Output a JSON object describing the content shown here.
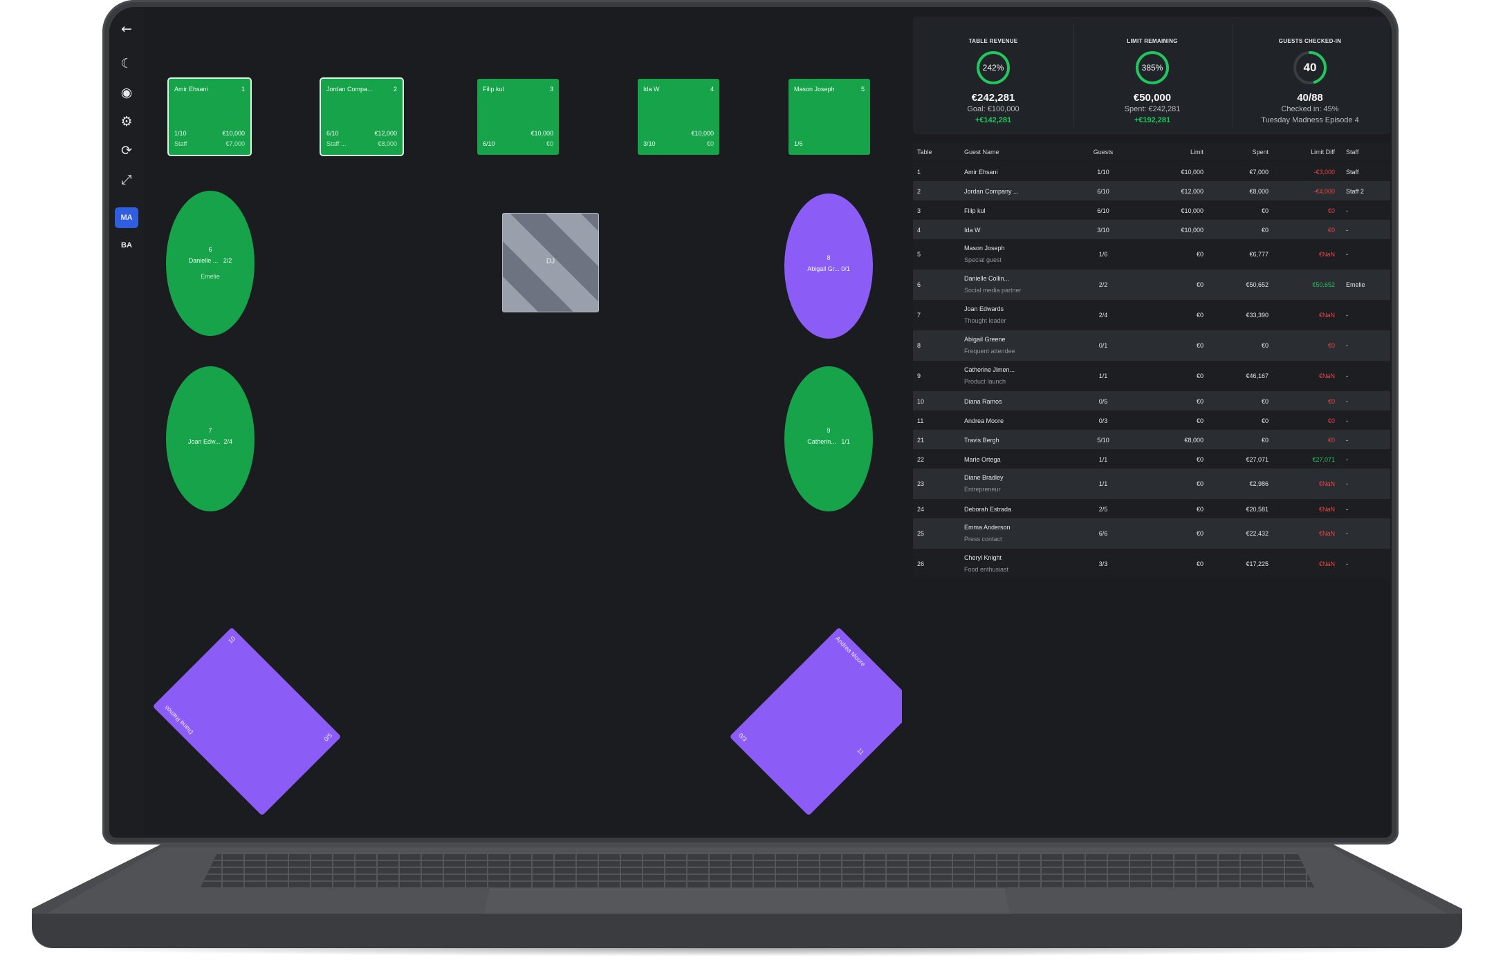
{
  "toolbar": {
    "badges": [
      "MA",
      "BA"
    ]
  },
  "tables": {
    "square": [
      {
        "name": "Amir Ehsani",
        "number": "1",
        "guests": "1/10",
        "limit": "€10,000",
        "staff": "Staff",
        "spent": "€7,000"
      },
      {
        "name": "Jordan Compa...",
        "number": "2",
        "guests": "6/10",
        "limit": "€12,000",
        "staff": "Staff ...",
        "spent": "€8,000"
      },
      {
        "name": "Filip kul",
        "number": "3",
        "guests": "6/10",
        "limit": "€10,000",
        "staff": "",
        "spent": "€0"
      },
      {
        "name": "Ida W",
        "number": "4",
        "guests": "3/10",
        "limit": "€10,000",
        "staff": "",
        "spent": "€0"
      },
      {
        "name": "Mason Joseph",
        "number": "5",
        "guests": "1/6",
        "limit": "",
        "staff": "",
        "spent": ""
      }
    ],
    "oval": [
      {
        "number": "6",
        "label": "Danielle ...",
        "count": "2/2",
        "extra": "Emelie"
      },
      {
        "number": "8",
        "label": "Abigail Gr...",
        "count": "0/1",
        "extra": ""
      },
      {
        "number": "7",
        "label": "Joan Edw...",
        "count": "2/4",
        "extra": ""
      },
      {
        "number": "9",
        "label": "Catherin...",
        "count": "1/1",
        "extra": ""
      }
    ],
    "dj_label": "DJ",
    "rotated": [
      {
        "name": "Diana Ramos",
        "number": "10",
        "count": "0/5"
      },
      {
        "name": "Andrea Moore",
        "number": "11",
        "count": "0/3"
      }
    ]
  },
  "stats": [
    {
      "label": "TABLE REVENUE",
      "ring_text": "242%",
      "value": "€242,281",
      "sub": "Goal: €100,000",
      "note": "+€142,281",
      "ring_fraction": 1.0
    },
    {
      "label": "LIMIT REMAINING",
      "ring_text": "385%",
      "value": "€50,000",
      "sub": "Spent: €242,281",
      "note": "+€192,281",
      "ring_fraction": 1.0
    },
    {
      "label": "GUESTS CHECKED-IN",
      "ring_text": "40",
      "value": "40/88",
      "sub": "Checked in: 45%",
      "note": "Tuesday Madness Episode 4",
      "ring_fraction": 0.45
    }
  ],
  "table_headers": [
    "Table",
    "Guest Name",
    "Guests",
    "Limit",
    "Spent",
    "Limit Diff",
    "Staff"
  ],
  "rows": [
    {
      "table": "1",
      "name": "Amir Ehsani",
      "note": "",
      "guests": "1/10",
      "limit": "€10,000",
      "spent": "€7,000",
      "diff": "-€3,000",
      "diff_type": "neg",
      "staff": "Staff"
    },
    {
      "table": "2",
      "name": "Jordan Company ...",
      "note": "",
      "guests": "6/10",
      "limit": "€12,000",
      "spent": "€8,000",
      "diff": "-€4,000",
      "diff_type": "neg",
      "staff": "Staff 2"
    },
    {
      "table": "3",
      "name": "Filip kul",
      "note": "",
      "guests": "6/10",
      "limit": "€10,000",
      "spent": "€0",
      "diff": "€0",
      "diff_type": "neg",
      "staff": "-"
    },
    {
      "table": "4",
      "name": "Ida W",
      "note": "",
      "guests": "3/10",
      "limit": "€10,000",
      "spent": "€0",
      "diff": "€0",
      "diff_type": "neg",
      "staff": "-"
    },
    {
      "table": "5",
      "name": "Mason Joseph",
      "note": "Special guest",
      "guests": "1/6",
      "limit": "€0",
      "spent": "€6,777",
      "diff": "€NaN",
      "diff_type": "neg",
      "staff": "-"
    },
    {
      "table": "6",
      "name": "Danielle Collin...",
      "note": "Social media partner",
      "guests": "2/2",
      "limit": "€0",
      "spent": "€50,652",
      "diff": "€50,652",
      "diff_type": "pos",
      "staff": "Emelie"
    },
    {
      "table": "7",
      "name": "Joan Edwards",
      "note": "Thought leader",
      "guests": "2/4",
      "limit": "€0",
      "spent": "€33,390",
      "diff": "€NaN",
      "diff_type": "neg",
      "staff": "-"
    },
    {
      "table": "8",
      "name": "Abigail Greene",
      "note": "Frequent attendee",
      "guests": "0/1",
      "limit": "€0",
      "spent": "€0",
      "diff": "€0",
      "diff_type": "neg",
      "staff": "-"
    },
    {
      "table": "9",
      "name": "Catherine Jimen...",
      "note": "Product launch",
      "guests": "1/1",
      "limit": "€0",
      "spent": "€46,167",
      "diff": "€NaN",
      "diff_type": "neg",
      "staff": "-"
    },
    {
      "table": "10",
      "name": "Diana Ramos",
      "note": "",
      "guests": "0/5",
      "limit": "€0",
      "spent": "€0",
      "diff": "€0",
      "diff_type": "neg",
      "staff": "-"
    },
    {
      "table": "11",
      "name": "Andrea Moore",
      "note": "",
      "guests": "0/3",
      "limit": "€0",
      "spent": "€0",
      "diff": "€0",
      "diff_type": "neg",
      "staff": "-"
    },
    {
      "table": "21",
      "name": "Travis Bergh",
      "note": "",
      "guests": "5/10",
      "limit": "€8,000",
      "spent": "€0",
      "diff": "€0",
      "diff_type": "neg",
      "staff": "-"
    },
    {
      "table": "22",
      "name": "Marie Ortega",
      "note": "",
      "guests": "1/1",
      "limit": "€0",
      "spent": "€27,071",
      "diff": "€27,071",
      "diff_type": "pos",
      "staff": "-"
    },
    {
      "table": "23",
      "name": "Diane Bradley",
      "note": "Entrepreneur",
      "guests": "1/1",
      "limit": "€0",
      "spent": "€2,986",
      "diff": "€NaN",
      "diff_type": "neg",
      "staff": "-"
    },
    {
      "table": "24",
      "name": "Deborah Estrada",
      "note": "",
      "guests": "2/5",
      "limit": "€0",
      "spent": "€20,581",
      "diff": "€NaN",
      "diff_type": "neg",
      "staff": "-"
    },
    {
      "table": "25",
      "name": "Emma Anderson",
      "note": "Press contact",
      "guests": "6/6",
      "limit": "€0",
      "spent": "€22,432",
      "diff": "€NaN",
      "diff_type": "neg",
      "staff": "-"
    },
    {
      "table": "26",
      "name": "Cheryl Knight",
      "note": "Food enthusiast",
      "guests": "3/3",
      "limit": "€0",
      "spent": "€17,225",
      "diff": "€NaN",
      "diff_type": "neg",
      "staff": "-"
    }
  ]
}
